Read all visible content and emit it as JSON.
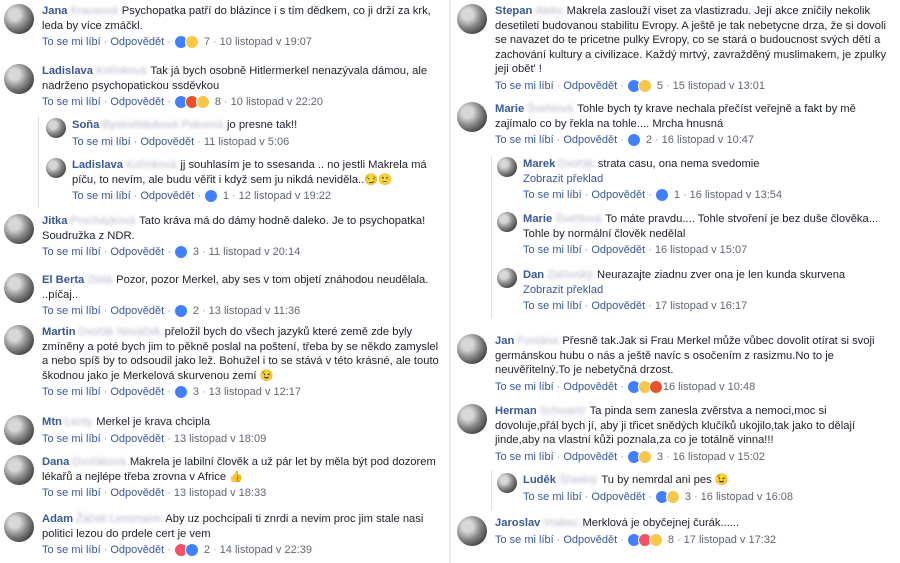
{
  "ui": {
    "like": "To se mi líbí",
    "reply": "Odpovědět",
    "translate": "Zobrazit překlad"
  },
  "left": [
    {
      "first": "Jana",
      "last": "Krausová",
      "text": "Psychopatka patří do blázince i s tím dědkem, co ji drží za krk, leda by více zmáčkl.",
      "reactions": [
        "like",
        "haha"
      ],
      "count": "7",
      "time": "10 listopad v 19:07",
      "reply": false
    },
    {
      "first": "Ladislava",
      "last": "Kořínková",
      "text": "Tak já bych osobně Hitlermerkel nenazývala dámou, ale nadrženo psychopatickou ssděvkou",
      "reactions": [
        "like",
        "angry",
        "haha"
      ],
      "count": "8",
      "time": "10 listopad v 22:20",
      "reply": false
    },
    {
      "first": "Soňa",
      "last": "Bystrohlávková Pokorná",
      "text": "jo presne tak!!",
      "reactions": [],
      "count": "",
      "time": "11 listopad v 5:06",
      "reply": true
    },
    {
      "first": "Ladislava",
      "last": "Kořínková",
      "text": "jj souhlasím je to ssesanda .. no jestli Makrela má píču, to nevím, ale budu věřit i když sem ju nikdá neviděla..😏🙂",
      "reactions": [
        "like"
      ],
      "count": "1",
      "time": "12 listopad v 19:22",
      "reply": true
    },
    {
      "first": "Jitka",
      "last": "Procházková",
      "text": "Tato kráva má do dámy hodně daleko. Je to psychopatka! Soudružka z NDR.",
      "reactions": [
        "like"
      ],
      "count": "3",
      "time": "11 listopad v 20:14",
      "reply": false
    },
    {
      "first": "El Berta",
      "last": "Zlatá",
      "text": "Pozor, pozor Merkel, aby ses v tom objetí znáhodou neudělala. ..píčaj..",
      "reactions": [
        "like"
      ],
      "count": "2",
      "time": "13 listopad v 11:36",
      "reply": false
    },
    {
      "first": "Martin",
      "last": "Dvořák Nováček",
      "text": "přeložil bych do všech jazyků které země zde byly zmíněny a poté bych jim to pěkně poslal na poštení, třeba by se někdo zamyslel a nebo spíš by to odsoudil jako lež. Bohužel i to se stává v této krásné, ale touto škodnou jako je Merkelová skurvenou zemí 😉",
      "reactions": [
        "like"
      ],
      "count": "3",
      "time": "13 listopad v 12:17",
      "reply": false
    },
    {
      "first": "Mtn",
      "last": "Lenty",
      "text": "Merkel je krava chcipla",
      "reactions": [],
      "count": "",
      "time": "13 listopad v 18:09",
      "reply": false
    },
    {
      "first": "Dana",
      "last": "Dvořáková",
      "text": "Makrela je labilní člověk a už pár let by měla být pod dozorem lékařů a nejlépe třeba zrovna v Africe 👍",
      "reactions": [],
      "count": "",
      "time": "13 listopad v 18:33",
      "reply": false
    },
    {
      "first": "Adam",
      "last": "Žáček Lessmann",
      "text": "Aby uz pochcipali ti znrdi a nevim proc jim stale nasi politici lezou do prdele cert je vem",
      "reactions": [
        "love",
        "like"
      ],
      "count": "2",
      "time": "14 listopad v 22:39",
      "reply": false
    }
  ],
  "right": [
    {
      "first": "Stepan",
      "last": "Aleks",
      "text": "Makrela zaslouží viset za vlastizradu. Její akce zničily nekolik desetileti budovanou stabilitu Evropy. A ještě je tak nebetycne drza, že si dovoli se navazet do te pricetne pulky Evropy, co se stará o budoucnost svých dětí a zachování kultury a civilizace. Každý mrtvý, zavražděný muslimakem, je zpulky jeji obět' !",
      "reactions": [
        "like",
        "haha"
      ],
      "count": "5",
      "time": "15 listopad v 13:01",
      "reply": false
    },
    {
      "first": "Marie",
      "last": "Švehlová",
      "text": "Tohle bych ty krave nechala přečíst veřejně a fakt by mě zajímalo co by řekla na tohle.... Mrcha hnusná",
      "reactions": [
        "like"
      ],
      "count": "2",
      "time": "16 listopad v 10:47",
      "reply": false
    },
    {
      "first": "Marek",
      "last": "Dvořák",
      "text": "strata casu, ona nema svedomie",
      "reactions": [
        "like"
      ],
      "count": "1",
      "time": "16 listopad v 13:54",
      "reply": true,
      "translate": true
    },
    {
      "first": "Marie",
      "last": "Švehlová",
      "text": "To máte pravdu.... Tohle stvoření je bez duše člověka... Tohle by normální člověk nedělal",
      "reactions": [],
      "count": "",
      "time": "16 listopad v 15:07",
      "reply": true
    },
    {
      "first": "Dan",
      "last": "Zaťovský",
      "text": "Neurazajte ziadnu zver ona je len kunda skurvena",
      "reactions": [],
      "count": "",
      "time": "17 listopad v 16:17",
      "reply": true,
      "translate": true
    },
    {
      "first": "Jan",
      "last": "Fontána",
      "text": "Přesně tak.Jak si Frau Merkel může vůbec dovolit otírat si svoji germánskou hubu o nás a ještě navíc s osočením z rasizmu.No to je neuvěřitelný.To je nebetyčná drzost.",
      "reactions": [
        "like",
        "wow",
        "angry"
      ],
      "count": "",
      "time": "16 listopad v 10:48",
      "reply": false
    },
    {
      "first": "Herman",
      "last": "Schwartz",
      "text": "Ta pinda sem zanesla zvěrstva a nemoci,moc si dovoluje,přál bych jí, aby ji třicet snědých klučíků ukojilo,tak jako to dělají jinde,aby na vlastní kůži poznala,za co je totálně vinna!!!",
      "reactions": [
        "like",
        "haha"
      ],
      "count": "3",
      "time": "16 listopad v 15:02",
      "reply": false
    },
    {
      "first": "Luděk",
      "last": "Šťastný",
      "text": "Tu by nemrdal ani pes 😉",
      "reactions": [
        "like",
        "haha"
      ],
      "count": "3",
      "time": "16 listopad v 16:08",
      "reply": true
    },
    {
      "first": "Jaroslav",
      "last": "Vrabec",
      "text": "Merklová je obyčejnej čurák......",
      "reactions": [
        "like",
        "love",
        "haha"
      ],
      "count": "8",
      "time": "17 listopad v 17:32",
      "reply": false
    }
  ]
}
